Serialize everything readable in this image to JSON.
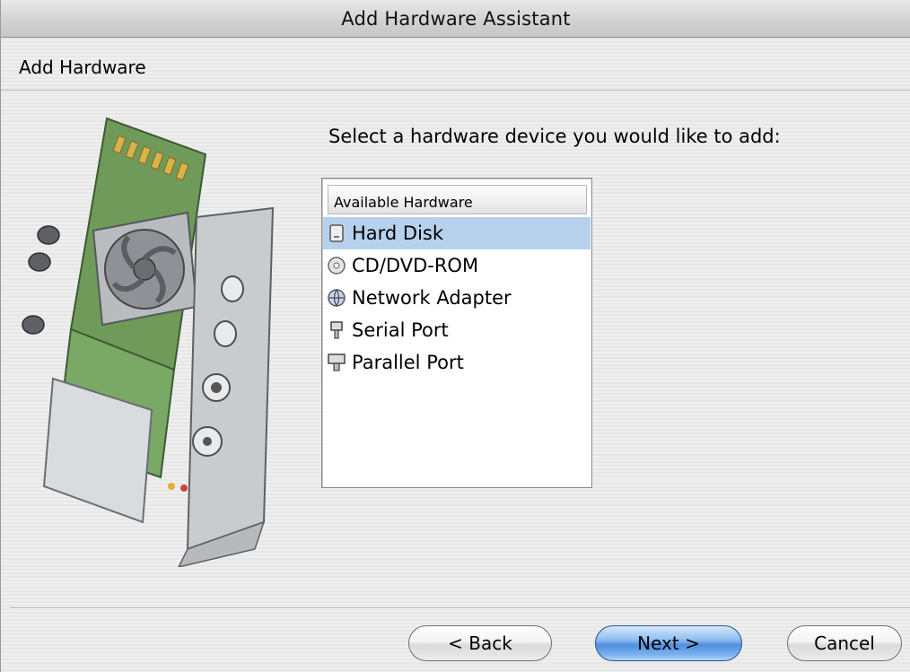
{
  "window": {
    "title": "Add Hardware Assistant"
  },
  "header": {
    "title": "Add Hardware"
  },
  "prompt": "Select a hardware device you would like to add:",
  "list": {
    "header": "Available Hardware",
    "items": [
      {
        "label": "Hard Disk",
        "icon": "hard-disk-icon",
        "selected": true
      },
      {
        "label": "CD/DVD-ROM",
        "icon": "cd-dvd-icon",
        "selected": false
      },
      {
        "label": "Network Adapter",
        "icon": "network-adapter-icon",
        "selected": false
      },
      {
        "label": "Serial Port",
        "icon": "serial-port-icon",
        "selected": false
      },
      {
        "label": "Parallel Port",
        "icon": "parallel-port-icon",
        "selected": false
      }
    ]
  },
  "buttons": {
    "back": "< Back",
    "next": "Next >",
    "cancel": "Cancel"
  },
  "colors": {
    "selection": "#b6d1ec",
    "default_button": "#4d8fe0",
    "board_green": "#6f9a5a"
  }
}
